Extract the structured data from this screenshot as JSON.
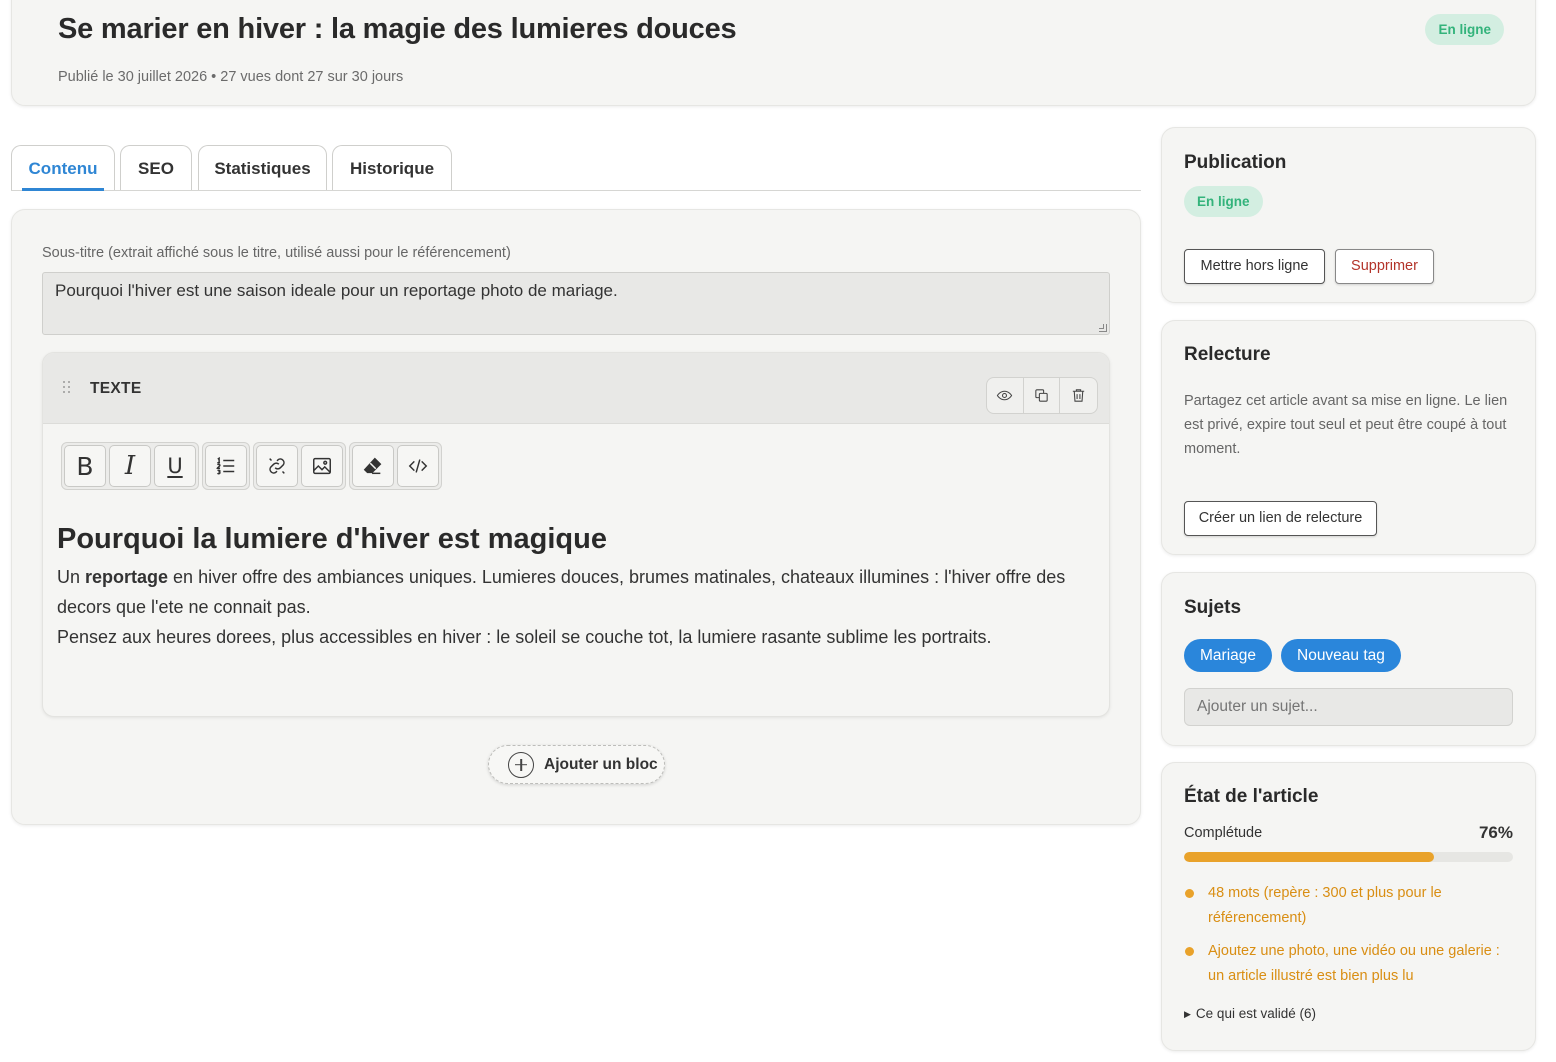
{
  "header": {
    "title": "Se marier en hiver : la magie des lumieres douces",
    "meta": "Publié le 30 juillet 2026 • 27 vues dont 27 sur 30 jours",
    "status_badge": "En ligne"
  },
  "tabs": [
    {
      "label": "Contenu",
      "active": true
    },
    {
      "label": "SEO",
      "active": false
    },
    {
      "label": "Statistiques",
      "active": false
    },
    {
      "label": "Historique",
      "active": false
    }
  ],
  "content": {
    "subtitle_label": "Sous-titre (extrait affiché sous le titre, utilisé aussi pour le référencement)",
    "subtitle_value": "Pourquoi l'hiver est une saison ideale pour un reportage photo de mariage.",
    "block": {
      "type_label": "TEXTE",
      "heading": "Pourquoi la lumiere d'hiver est magique",
      "p1_prefix": "Un ",
      "p1_bold": "reportage",
      "p1_suffix": " en hiver offre des ambiances uniques. Lumieres douces, brumes matinales, chateaux illumines : l'hiver offre des decors que l'ete ne connait pas.",
      "p2": "Pensez aux heures dorees, plus accessibles en hiver : le soleil se couche tot, la lumiere rasante sublime les portraits."
    },
    "toolbar_icons": [
      "bold-icon",
      "italic-icon",
      "underline-icon",
      "ordered-list-icon",
      "link-icon",
      "image-icon",
      "eraser-icon",
      "code-icon"
    ],
    "block_action_icons": [
      "eye-icon",
      "copy-icon",
      "trash-icon"
    ],
    "add_block_label": "Ajouter un bloc"
  },
  "sidebar": {
    "publication": {
      "title": "Publication",
      "status_badge": "En ligne",
      "unpublish_label": "Mettre hors ligne",
      "delete_label": "Supprimer"
    },
    "review": {
      "title": "Relecture",
      "description": "Partagez cet article avant sa mise en ligne. Le lien est privé, expire tout seul et peut être coupé à tout moment.",
      "create_link_label": "Créer un lien de relecture"
    },
    "topics": {
      "title": "Sujets",
      "tags": [
        "Mariage",
        "Nouveau tag"
      ],
      "input_placeholder": "Ajouter un sujet..."
    },
    "article_state": {
      "title": "État de l'article",
      "completeness_label": "Complétude",
      "completeness_pct": "76%",
      "completeness_value": 0.76,
      "issues": [
        "48 mots (repère : 300 et plus pour le référencement)",
        "Ajoutez une photo, une vidéo ou une galerie : un article illustré est bien plus lu"
      ],
      "validated_summary": "Ce qui est validé (6)"
    }
  },
  "colors": {
    "accent": "#2f86d4",
    "tag_blue": "#2a86db",
    "success_badge_bg": "#d3eee1",
    "success_badge_text": "#33b37b",
    "warning": "#e9a22a",
    "danger": "#b3342a"
  }
}
